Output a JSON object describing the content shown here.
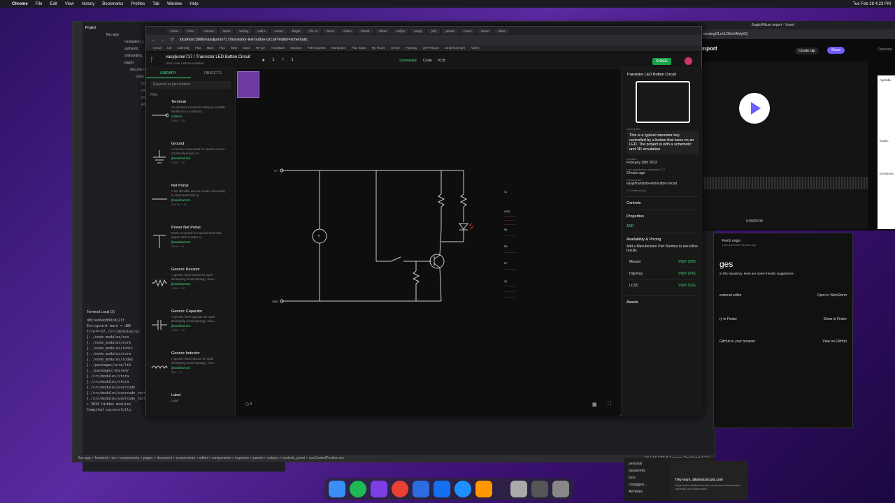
{
  "menubar": {
    "app": "Chrome",
    "items": [
      "File",
      "Edit",
      "View",
      "History",
      "Bookmarks",
      "Profiles",
      "Tab",
      "Window",
      "Help"
    ],
    "clock": "Tue Feb 28 4:23 PM"
  },
  "ide": {
    "project_label": "Project",
    "tree": [
      "flux-app",
      "navigation_c",
      "authentic",
      "onboarding_",
      "pages",
      "document",
      "comp",
      "clo",
      "cor",
      "cre",
      "edi"
    ],
    "terminal_header": "Terminal   Local (2)",
    "terminal_lines": [
      "d85fed6eb880cd221f",
      "Entrypoint main = d85",
      "t?ref=~8!./src/modules/us",
      "[../node_modules/coo",
      "[../node_modules/core",
      "[../node_modules/ionic",
      "[../node_modules/core",
      "[../node_modules/lodas",
      "[../packages/core/lib",
      "[../packages/shared/",
      "[./src/modules/stora",
      "[./src/modules/stora",
      "[./src/modules/usercode",
      "[./src/modules/usercode_runtime/helpers/initialiseNodes.ts] 18.3 KiB {main}",
      "[./src/modules/usercode_runtime/models/CurrentSource.ts] 1.01 KiB {main}",
      "+ 3034 hidden modules",
      "Compiled successfully."
    ],
    "statusbar": "flux-app > frontend > src > components > pages > document > components > editor > components > inspector > panels > subject > controls_panel > useControlPosition.tsx",
    "status_right": "16:1  LF  UTF-8  4 spaces  TypeScript 4.7.4"
  },
  "browser": {
    "tabs": [
      "Inbox",
      "Flux -",
      "docum",
      "Work",
      "Wiring",
      "Add s",
      "comm",
      "Eagle",
      "Fix cu",
      "Move",
      "Calcu",
      "FluxSt",
      "Token",
      "cli@m",
      "vasylj",
      "(24)",
      "javasc",
      "How t",
      "Searc",
      "allow"
    ],
    "url": "localhost:3000/vasyljunior717/transistor-led-button-circuit?editor=schematic",
    "bookmarks": [
      "Gmail",
      "Cal",
      "Calendly",
      "Flux",
      "Main",
      "Flux",
      "SEO",
      "Docs",
      "RF QA",
      "Amplitude",
      "Deploys",
      "Pull requests",
      "Workplace",
      "Flux Slack",
      "My Room",
      "Sentry",
      "PopSQL",
      "gTF Report",
      "JS Benchmark",
      "Admin"
    ]
  },
  "app": {
    "title": "vasyljunior717 / Transistor LED Button Circuit",
    "subtitle": "User code runtime updated",
    "modes": [
      "Schematic",
      "Code",
      "PCB"
    ],
    "share": "SHARE",
    "library_tabs": [
      "LIBRARY",
      "OBJECTS"
    ],
    "search_placeholder": "Keyword or part number",
    "filter": "Filter",
    "parts": [
      {
        "name": "Terminal",
        "desc": "An electrical connector acting as reusable interface to a conductor...",
        "author": "natarius",
        "stats": "5.4M  ☆ 39"
      },
      {
        "name": "Ground",
        "desc": "A common return path for electric current. Commonly known as...",
        "author": "jharwinbarrozo",
        "stats": "5.4M  ☆ 39"
      },
      {
        "name": "Net Portal",
        "desc": "A net identifier used to create connectivity to other Net Portal wi...",
        "author": "jharwinbarrozo",
        "stats": "268.2k  ☆ 11"
      },
      {
        "name": "Power Net Portal",
        "desc": "Power net portal is a special schematic object used to define a...",
        "author": "jharwinbarrozo",
        "stats": "73.6k  ☆ 6"
      },
      {
        "name": "Generic Resistor",
        "desc": "A generic fixed resistor for rapid developing circuit topology. Save...",
        "author": "jharwinbarrozo",
        "stats": "1.2M  ☆ 29"
      },
      {
        "name": "Generic Capacitor",
        "desc": "A generic fixed capacitor for rapid developing circuit topology. Save...",
        "author": "jharwinbarrozo",
        "stats": "1.4M  ☆ 18"
      },
      {
        "name": "Generic Inductor",
        "desc": "A generic fixed inductor for rapid developing circuit topology. *You...",
        "author": "jharwinbarrozo",
        "stats": "981  ☆ 6"
      },
      {
        "name": "Label",
        "desc": "Label",
        "author": "",
        "stats": ""
      }
    ],
    "canvas": {
      "net_v": "V+",
      "net_gnd": "GND",
      "comments": "0"
    },
    "inspector": {
      "title": "Transistor LED Button Circuit",
      "desc_label": "Description",
      "description": "This is a typical transistor key controlled by a button that turns on an LED. The project is with a schematic and 3D simulation",
      "created_label": "Created",
      "created": "February 28th 2023",
      "updated_label": "Last updated by vasyljunior717",
      "updated": "3 hours ago",
      "forked_label": "Forked from",
      "forked": "vasyl/transistor-led-button-circuit",
      "contributors": "1 Contributor(s)",
      "controls": "Controls",
      "properties": "Properties",
      "add": "ADD",
      "availability": "Availability & Pricing",
      "avail_hint": "Add a Manufacturer Part Number to see inline results.",
      "vendors": [
        {
          "name": "Mouser",
          "action": "VISIT SITE"
        },
        {
          "name": "Digi-Key",
          "action": "VISIT SITE"
        },
        {
          "name": "LCSC",
          "action": "VISIT SITE"
        }
      ],
      "assets": "Assets"
    }
  },
  "meet": {
    "title": "Eagle/Altium import - Vowel",
    "url": "meeting/2LoVLDEwVMrtyKQ",
    "heading": "mport",
    "create_clip": "Create clip",
    "share": "Share",
    "time": "0:00/29:09",
    "overview": "Overview",
    "agenda": "Agenda:",
    "goals": "Goals:",
    "decisions": "Decisions:"
  },
  "github": {
    "fetch": "Fetch origin",
    "fetched": "Last fetched 3 minutes ago",
    "heading": "ges",
    "suggest": "in this repository. Here are some friendly suggestions",
    "ext_editor": "external editor",
    "open_ws": "Open in WebStorm",
    "finder": "ry in Finder",
    "show_finder": "Show in Finder",
    "github": "GitHub in your browser",
    "view_gh": "View on GitHub"
  },
  "notes": {
    "items": [
      "personal",
      "passwords",
      "todo",
      "Untagged...",
      "All Notes"
    ],
    "title": "Hey team, allaboutcircuits.com",
    "snippet": "https://www.allaboutcircuits.com/news/exclusive/flux-ascends-out-of-beta-with-..."
  }
}
